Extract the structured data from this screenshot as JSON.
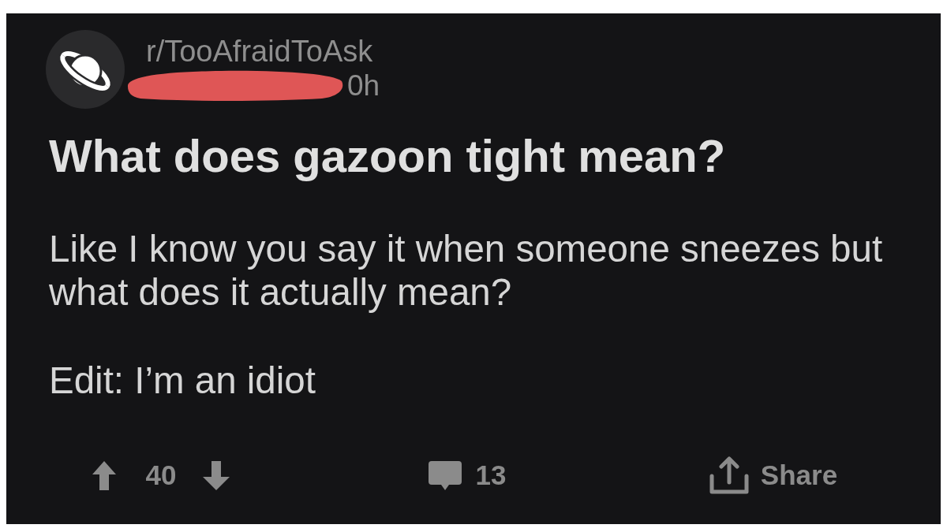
{
  "post": {
    "subreddit": "r/TooAfraidToAsk",
    "author_redacted": true,
    "time": "0h",
    "title": "What does gazoon tight mean?",
    "body": [
      "Like I know you say it when someone sneezes but what does it actually mean?",
      "Edit: I’m an idiot"
    ]
  },
  "actions": {
    "score": "40",
    "comments": "13",
    "share": "Share"
  }
}
